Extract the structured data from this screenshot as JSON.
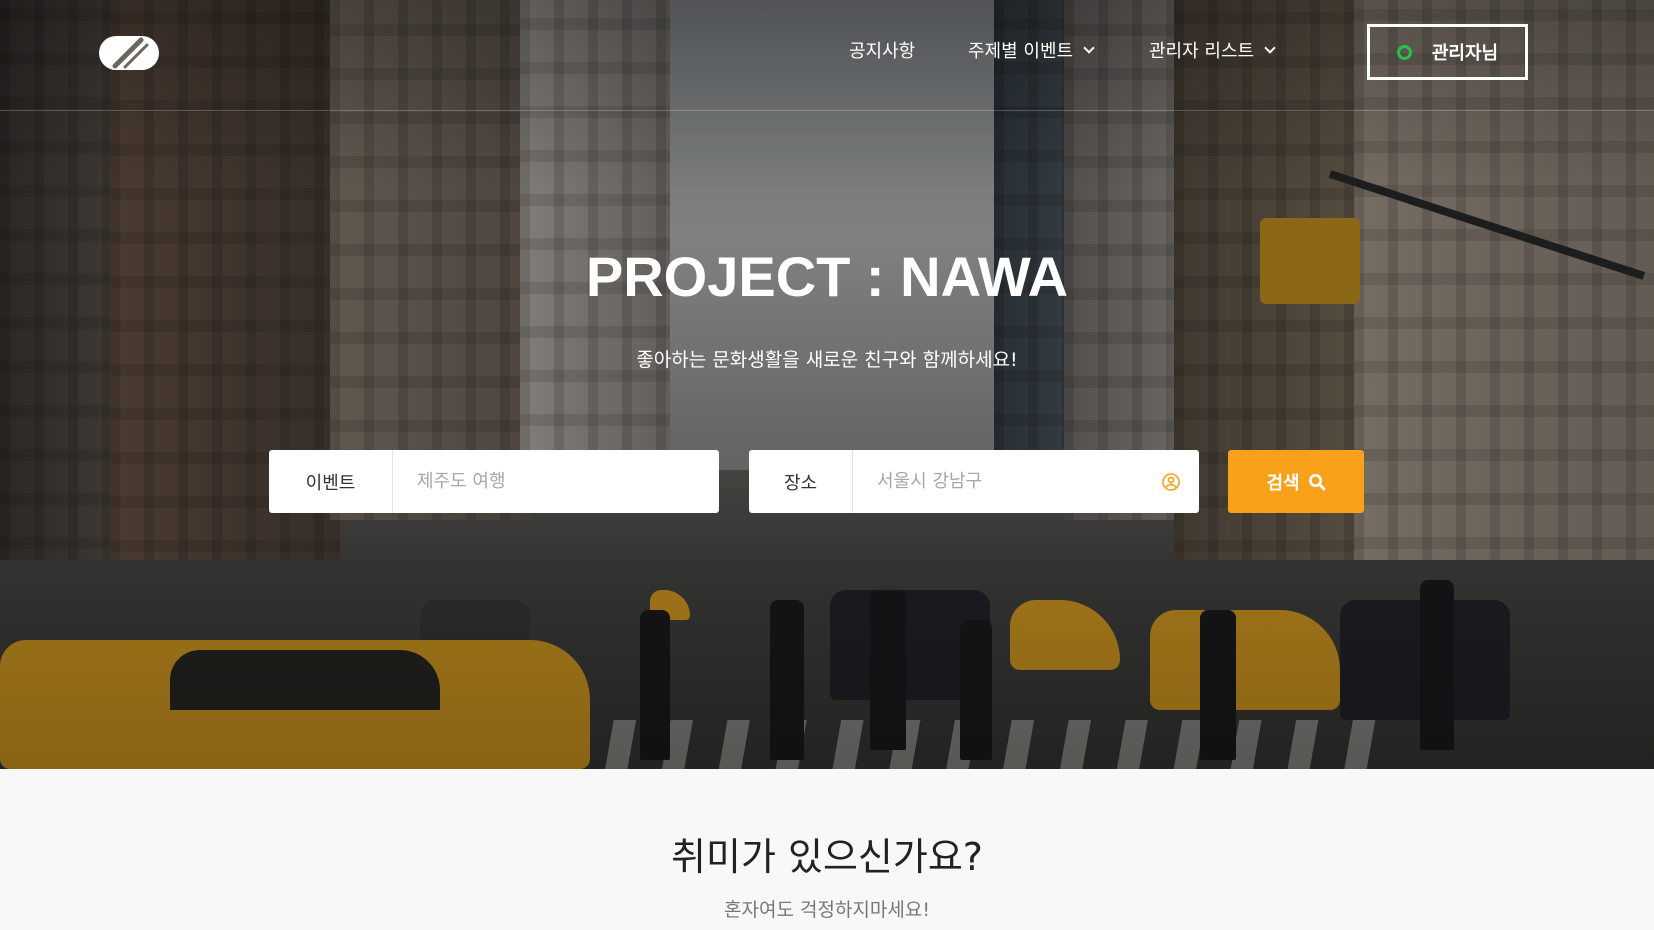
{
  "header": {
    "logo_icon": "brand-logo-icon",
    "nav": [
      {
        "label": "공지사항",
        "has_dropdown": false
      },
      {
        "label": "주제별 이벤트",
        "has_dropdown": true
      },
      {
        "label": "관리자 리스트",
        "has_dropdown": true
      }
    ],
    "admin_button": {
      "label": "관리자님",
      "status_color": "#27c24c"
    }
  },
  "hero": {
    "title": "PROJECT : NAWA",
    "subtitle": "좋아하는 문화생활을 새로운 친구와 함께하세요!",
    "search": {
      "event_label": "이벤트",
      "event_placeholder": "제주도 여행",
      "place_label": "장소",
      "place_placeholder": "서울시 강남구",
      "location_icon": "location-target-icon",
      "button_label": "검색",
      "button_icon": "search-icon",
      "button_color": "#f9a11b"
    }
  },
  "section": {
    "title": "취미가 있으신가요?",
    "subtitle": "혼자여도 걱정하지마세요!"
  }
}
